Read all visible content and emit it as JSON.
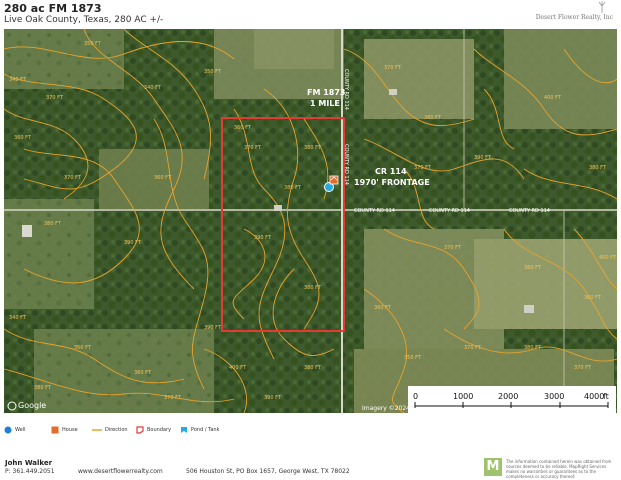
{
  "header": {
    "title": "280 ac FM 1873",
    "subtitle": "Live Oak County, Texas, 280 AC +/-",
    "brand": "Desert Flower Realty, Inc"
  },
  "map": {
    "labels": {
      "fm1873": [
        "FM 1873",
        "1 MILE"
      ],
      "cr114": [
        "CR 114",
        "1970' FRONTAGE"
      ]
    },
    "road_labels": [
      "COUNTY RD 114",
      "COUNTY RD 114",
      "COUNTY RD 114",
      "COUNTY RD 114",
      "COUNTY RD 114"
    ],
    "contour_labels": [
      "350 FT",
      "340 FT",
      "370 FT",
      "340 FT",
      "350 FT",
      "360 FT",
      "370 FT",
      "380 FT",
      "390 FT",
      "360 FT",
      "370 FT",
      "380 FT",
      "390 FT",
      "380 FT",
      "360 FT",
      "370 FT",
      "380 FT",
      "390 FT",
      "400 FT",
      "380 FT",
      "370 FT",
      "370 FT",
      "380 FT",
      "360 FT",
      "340 FT",
      "350 FT",
      "360 FT",
      "370 FT",
      "380 FT",
      "390 FT",
      "400 FT",
      "360 FT",
      "350 FT",
      "370 FT",
      "380 FT",
      "370 FT",
      "380 FT",
      "390 FT",
      "400 FT",
      "380 FT"
    ],
    "attribution": "Imagery ©2024",
    "logo": "Google",
    "scale": {
      "ticks": [
        "0",
        "1000",
        "2000",
        "3000",
        "4000"
      ],
      "unit": "ft"
    }
  },
  "legend": [
    {
      "label": "Well",
      "icon": "well-icon",
      "color": "#1e7fd6"
    },
    {
      "label": "House",
      "icon": "house-icon",
      "color": "#e56b2a"
    },
    {
      "label": "Direction",
      "icon": "direction-icon",
      "color": "#e8a32c"
    },
    {
      "label": "Boundary",
      "icon": "boundary-icon",
      "color": "#e53935"
    },
    {
      "label": "Pond / Tank",
      "icon": "pond-icon",
      "color": "#29a9e1"
    }
  ],
  "footer": {
    "name": "John Walker",
    "phone": "P: 361.449.2051",
    "website": "www.desertflowerrealty.com",
    "address": "506 Houston St, PO Box 1657, George West, TX 78022",
    "logo_letter": "M",
    "disclaimer": "The information contained herein was obtained from sources deemed to be reliable. MapRight Services makes no warranties or guarantees as to the completeness or accuracy thereof."
  },
  "colors": {
    "boundary": "#e53935",
    "contour": "#e8a32c",
    "road": "#ffffff"
  }
}
